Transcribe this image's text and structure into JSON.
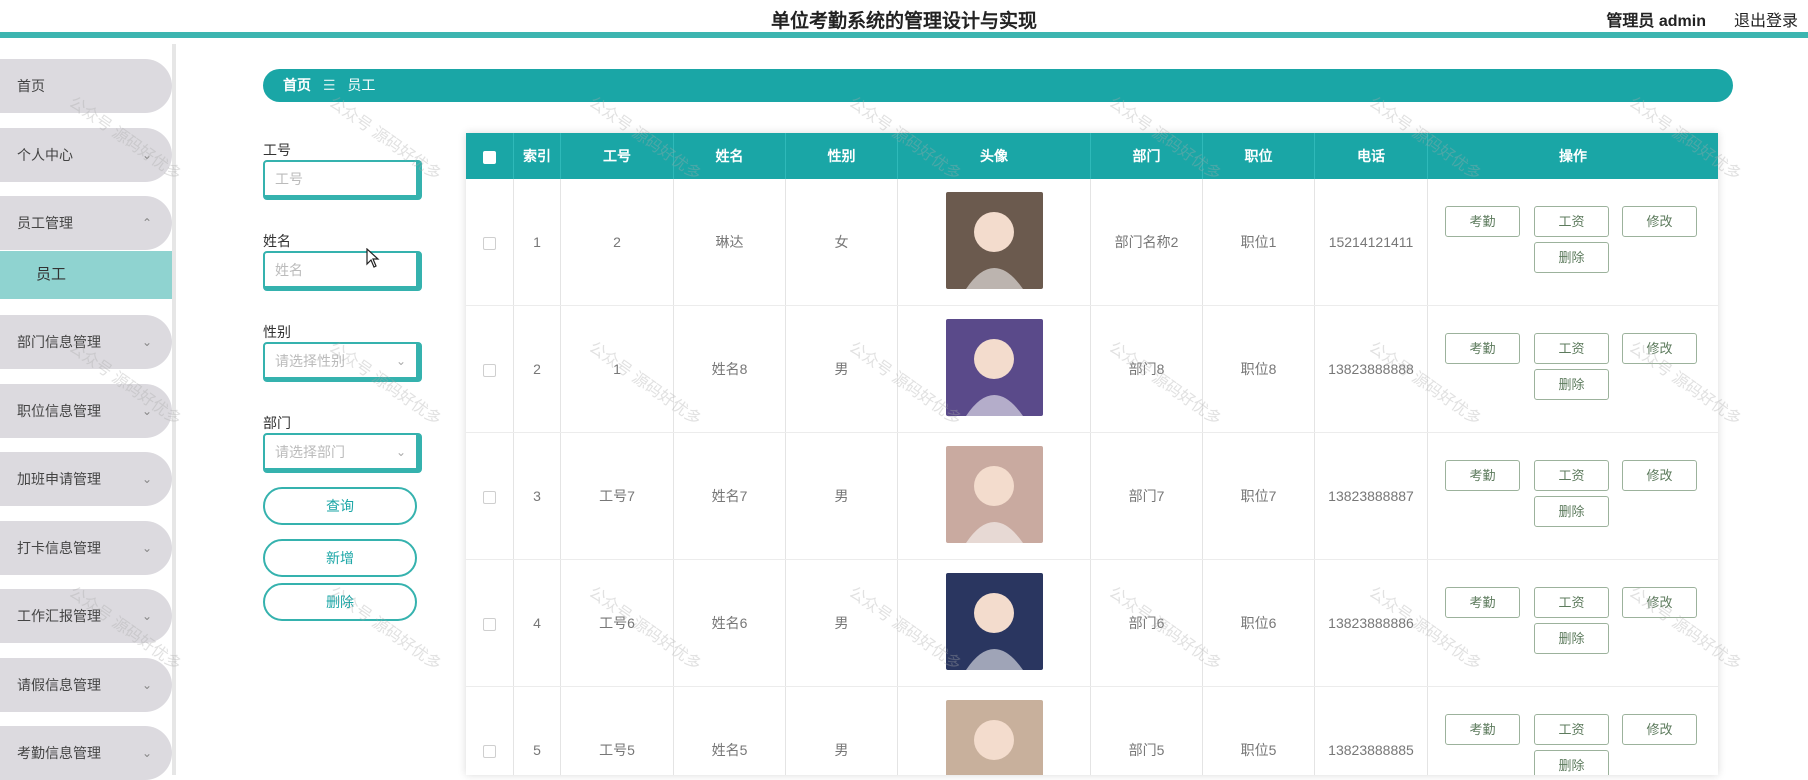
{
  "header": {
    "title": "单位考勤系统的管理设计与实现",
    "user": "管理员 admin",
    "logout": "退出登录"
  },
  "sidebar": {
    "items": [
      {
        "label": "首页",
        "expand": ""
      },
      {
        "label": "个人中心",
        "expand": "⌄"
      },
      {
        "label": "员工管理",
        "expand": "⌃"
      },
      {
        "label": "员工",
        "expand": "",
        "sub": true
      },
      {
        "label": "部门信息管理",
        "expand": "⌄"
      },
      {
        "label": "职位信息管理",
        "expand": "⌄"
      },
      {
        "label": "加班申请管理",
        "expand": "⌄"
      },
      {
        "label": "打卡信息管理",
        "expand": "⌄"
      },
      {
        "label": "工作汇报管理",
        "expand": "⌄"
      },
      {
        "label": "请假信息管理",
        "expand": "⌄"
      },
      {
        "label": "考勤信息管理",
        "expand": "⌄"
      }
    ]
  },
  "breadcrumb": {
    "home": "首页",
    "separator": "☰",
    "current": "员工"
  },
  "search": {
    "employee_no_label": "工号",
    "employee_no_placeholder": "工号",
    "name_label": "姓名",
    "name_placeholder": "姓名",
    "gender_label": "性别",
    "gender_placeholder": "请选择性别",
    "dept_label": "部门",
    "dept_placeholder": "请选择部门",
    "query_button": "查询",
    "add_button": "新增",
    "delete_button": "删除"
  },
  "table": {
    "headers": [
      "索引",
      "工号",
      "姓名",
      "性别",
      "头像",
      "部门",
      "职位",
      "电话",
      "操作"
    ],
    "rows": [
      {
        "index": "1",
        "no": "2",
        "name": "琳达",
        "gender": "女",
        "dept": "部门名称2",
        "position": "职位1",
        "phone": "15214121411",
        "avatar_color": "#6b5a4e"
      },
      {
        "index": "2",
        "no": "1",
        "name": "姓名8",
        "gender": "男",
        "dept": "部门8",
        "position": "职位8",
        "phone": "13823888888",
        "avatar_color": "#5a4a8a"
      },
      {
        "index": "3",
        "no": "工号7",
        "name": "姓名7",
        "gender": "男",
        "dept": "部门7",
        "position": "职位7",
        "phone": "13823888887",
        "avatar_color": "#c9aaa0"
      },
      {
        "index": "4",
        "no": "工号6",
        "name": "姓名6",
        "gender": "男",
        "dept": "部门6",
        "position": "职位6",
        "phone": "13823888886",
        "avatar_color": "#2a3660"
      },
      {
        "index": "5",
        "no": "工号5",
        "name": "姓名5",
        "gender": "男",
        "dept": "部门5",
        "position": "职位5",
        "phone": "13823888885",
        "avatar_color": "#c8b09c"
      }
    ],
    "actions": {
      "attendance": "考勤",
      "salary": "工资",
      "edit": "修改",
      "delete": "删除"
    }
  },
  "watermark_text": "公众号 源码好优多",
  "colors": {
    "accent": "#1aa6a6",
    "menu_bg": "#dcdadf",
    "active_sub": "#8fd3d0"
  }
}
